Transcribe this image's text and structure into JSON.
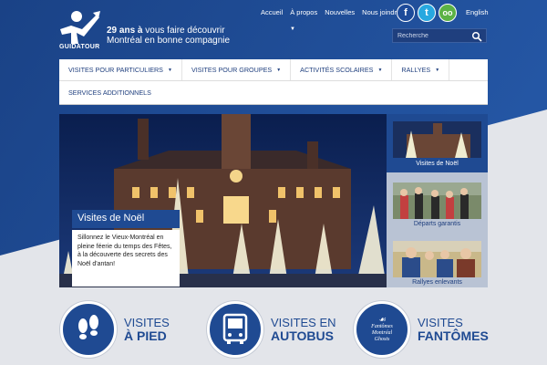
{
  "header": {
    "logo_text": "GUIDATOUR",
    "tagline_bold": "29 ans à",
    "tagline_rest": "vous faire découvrir Montréal en bonne compagnie",
    "top_links": [
      "Accueil",
      "À propos",
      "Nouvelles",
      "Nous joindre"
    ],
    "social": [
      {
        "name": "facebook-icon",
        "glyph": "f"
      },
      {
        "name": "twitter-icon",
        "glyph": "t"
      },
      {
        "name": "tripadvisor-icon",
        "glyph": "oo"
      }
    ],
    "lang": "English",
    "search_placeholder": "Recherche"
  },
  "menu": {
    "row1": [
      {
        "label": "VISITES POUR PARTICULIERS",
        "dropdown": true
      },
      {
        "label": "VISITES POUR GROUPES",
        "dropdown": true
      },
      {
        "label": "ACTIVITÉS SCOLAIRES",
        "dropdown": true
      },
      {
        "label": "RALLYES",
        "dropdown": true
      }
    ],
    "row2": [
      {
        "label": "SERVICES ADDITIONNELS",
        "dropdown": false
      }
    ]
  },
  "hero": {
    "title": "Visites de Noël",
    "description": "Sillonnez le Vieux-Montréal en pleine féerie du temps des Fêtes, à la découverte des secrets des Noël d'antan!"
  },
  "side": [
    {
      "label": "Visites de Noël",
      "active": true
    },
    {
      "label": "Départs garantis",
      "active": false
    },
    {
      "label": "Rallyes enlevants",
      "active": false
    }
  ],
  "bottom": [
    {
      "line1": "VISITES",
      "line2": "À PIED",
      "icon": "footprints-icon"
    },
    {
      "line1": "VISITES EN",
      "line2": "AUTOBUS",
      "icon": "bus-icon"
    },
    {
      "line1": "VISITES",
      "line2": "FANTÔMES",
      "icon": "ghost-logo-icon",
      "badge": [
        "Fantômes",
        "Montréal",
        "Ghosts"
      ]
    }
  ],
  "colors": {
    "primary": "#1f4a92",
    "dark_blue": "#123a7a",
    "facebook": "#1d4b9a",
    "twitter": "#27a8e0",
    "tripadvisor": "#5bb245",
    "background": "#e3e5ea"
  }
}
